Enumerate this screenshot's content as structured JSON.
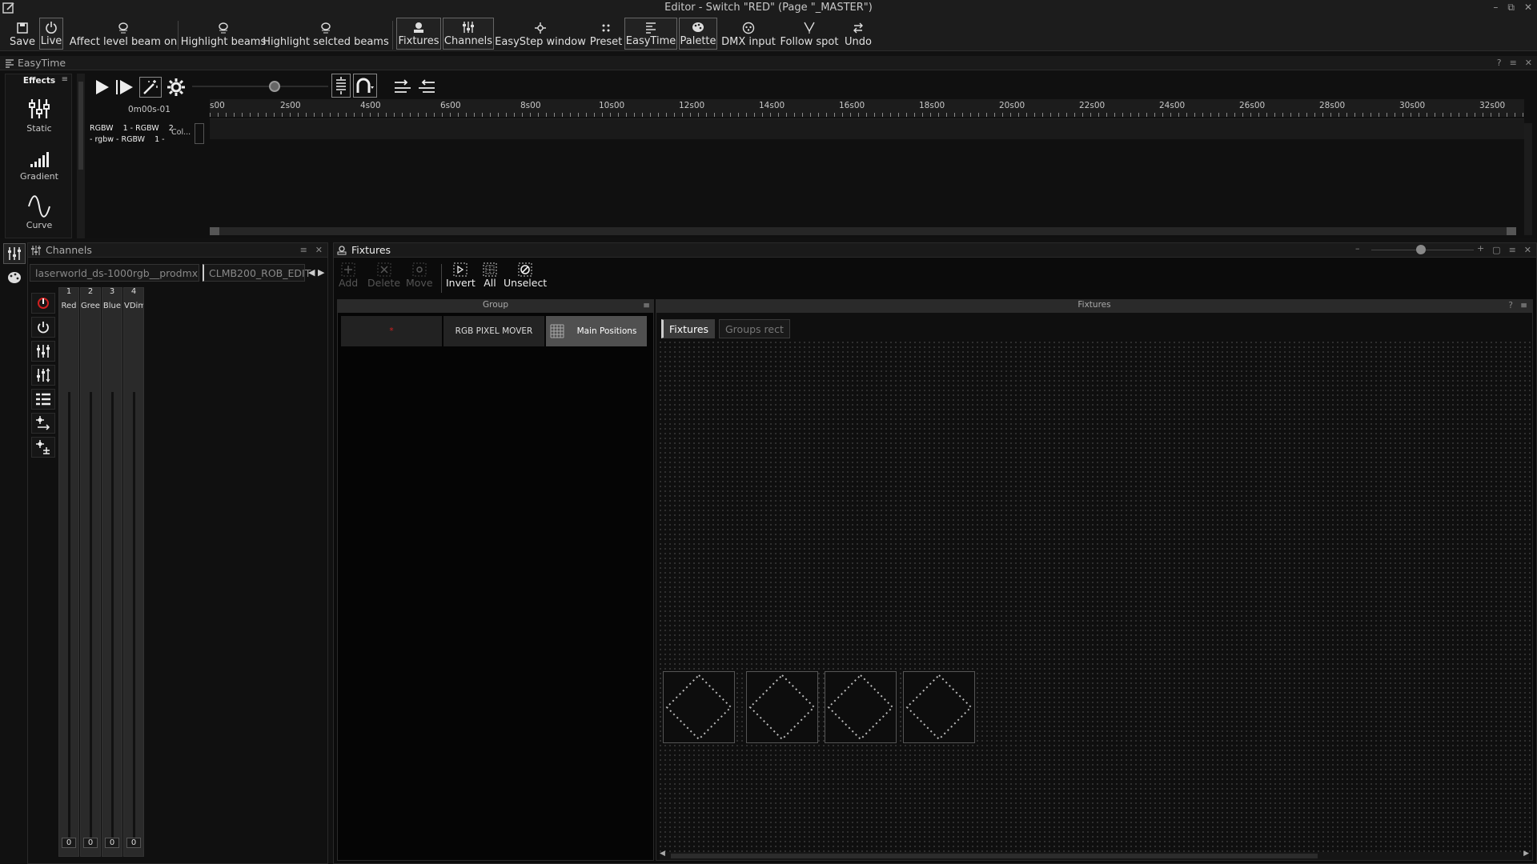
{
  "window": {
    "title": "Editor - Switch \"RED\" (Page \"_MASTER\")"
  },
  "toolbar": {
    "items": [
      {
        "label": "Save",
        "icon": "save-icon"
      },
      {
        "label": "Live",
        "icon": "power-icon"
      },
      {
        "label": "Affect level beam on",
        "icon": "beam-icon"
      },
      {
        "label": "Highlight beams",
        "icon": "beam-icon"
      },
      {
        "label": "Highlight selcted beams",
        "icon": "beam-icon"
      },
      {
        "label": "Fixtures",
        "icon": "fixture-icon"
      },
      {
        "label": "Channels",
        "icon": "sliders-icon"
      },
      {
        "label": "EasyStep window",
        "icon": "easystep-icon"
      },
      {
        "label": "Preset",
        "icon": "preset-icon"
      },
      {
        "label": "EasyTime",
        "icon": "easytime-icon"
      },
      {
        "label": "Palette",
        "icon": "palette-icon"
      },
      {
        "label": "DMX input",
        "icon": "dmx-icon"
      },
      {
        "label": "Follow spot",
        "icon": "follow-spot-icon"
      },
      {
        "label": "Undo",
        "icon": "undo-icon"
      }
    ]
  },
  "easytime": {
    "title": "EasyTime",
    "effects_header": "Effects",
    "effects": [
      {
        "label": "Static"
      },
      {
        "label": "Gradient"
      },
      {
        "label": "Curve"
      }
    ],
    "time_display": "0m00s-01",
    "ruler": [
      "s00",
      "2s00",
      "4s00",
      "6s00",
      "8s00",
      "10s00",
      "12s00",
      "14s00",
      "16s00",
      "18s00",
      "20s00",
      "22s00",
      "24s00",
      "26s00",
      "28s00",
      "30s00",
      "32s00"
    ],
    "track": {
      "line1": "RGBW    1 - RGBW    2",
      "line2": "- rgbw - RGBW    1 -",
      "col_label": "Col..."
    }
  },
  "channels": {
    "title": "Channels",
    "tabs": [
      "laserworld_ds-1000rgb__prodmx",
      "CLMB200_ROB_EDIT"
    ],
    "faders": [
      {
        "num": "1",
        "label": "Red",
        "value": "0"
      },
      {
        "num": "2",
        "label": "Green",
        "value": "0"
      },
      {
        "num": "3",
        "label": "Blue",
        "value": "0"
      },
      {
        "num": "4",
        "label": "VDim",
        "value": "0"
      }
    ]
  },
  "fixtures": {
    "title": "Fixtures",
    "tools": [
      {
        "label": "Add",
        "enabled": false
      },
      {
        "label": "Delete",
        "enabled": false
      },
      {
        "label": "Move",
        "enabled": false
      },
      {
        "label": "Invert",
        "enabled": true
      },
      {
        "label": "All",
        "enabled": true
      },
      {
        "label": "Unselect",
        "enabled": true
      }
    ],
    "group_header": "Group",
    "groups": [
      {
        "label": "*"
      },
      {
        "label": "RGB PIXEL MOVER"
      },
      {
        "label": "Main Positions"
      }
    ],
    "view_header": "Fixtures",
    "view_tabs": [
      "Fixtures",
      "Groups rect"
    ],
    "fixture_count": 4
  },
  "colors": {
    "background": "#111111",
    "panel": "#1c1c1c",
    "accent_red": "#d02020",
    "selected_group": "#505050"
  }
}
